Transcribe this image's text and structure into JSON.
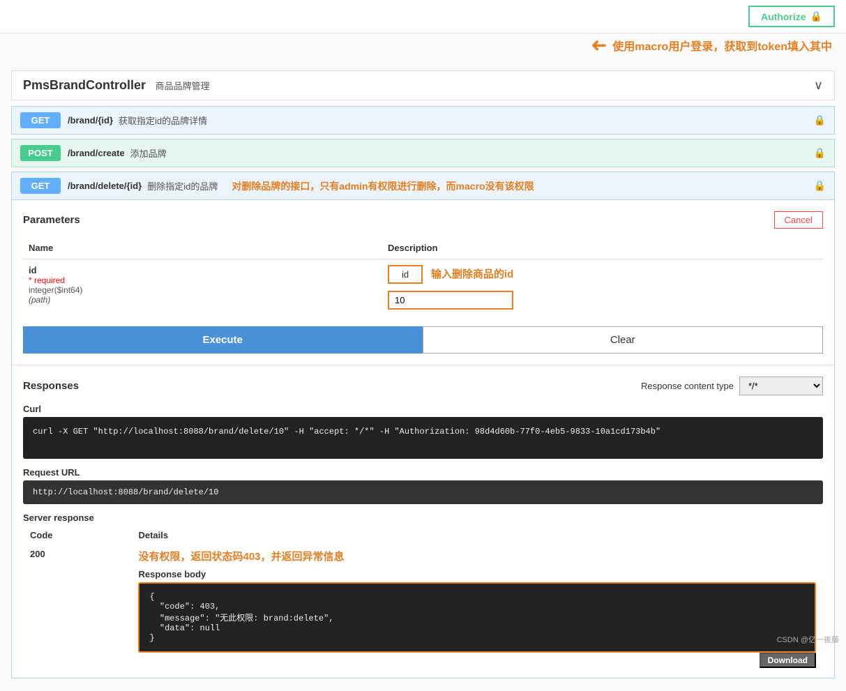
{
  "topbar": {
    "authorize_label": "Authorize",
    "lock_icon": "🔒"
  },
  "annotation": {
    "top_text": "使用macro用户登录，获取到token填入其中",
    "delete_annotation": "对删除品牌的接口，只有admin有权限进行删除，而macro没有该权限",
    "id_annotation": "输入删除商品的id",
    "no_permission_annotation": "没有权限，返回状态码403，并返回异常信息"
  },
  "controller": {
    "title": "PmsBrandController",
    "subtitle": "商品品牌管理"
  },
  "endpoints": [
    {
      "method": "GET",
      "path": "/brand/{id}",
      "desc": "获取指定id的品牌详情"
    },
    {
      "method": "POST",
      "path": "/brand/create",
      "desc": "添加品牌"
    }
  ],
  "expanded_endpoint": {
    "method": "GET",
    "path": "/brand/delete/{id}",
    "desc": "删除指定id的品牌"
  },
  "parameters": {
    "title": "Parameters",
    "cancel_label": "Cancel",
    "columns": {
      "name": "Name",
      "description": "Description"
    },
    "param": {
      "name": "id",
      "required_text": "* required",
      "type": "integer($int64)",
      "location": "(path)",
      "label": "id",
      "value": "10"
    }
  },
  "buttons": {
    "execute": "Execute",
    "clear": "Clear"
  },
  "responses": {
    "title": "Responses",
    "content_type_label": "Response content type",
    "content_type_value": "*/*",
    "curl_label": "Curl",
    "curl_value": "curl -X GET \"http://localhost:8088/brand/delete/10\" -H \"accept: */*\" -H \"Authorization: 98d4d60b-77f0-4eb5-9833-10a1cd173b4b\"",
    "request_url_label": "Request URL",
    "request_url_value": "http://localhost:8088/brand/delete/10",
    "server_response_label": "Server response",
    "code_header": "Code",
    "details_header": "Details",
    "code_200": "200",
    "response_body_label": "Response body",
    "response_body_json": "{\n  \"code\": 403,\n  \"message\": \"无此权限: brand:delete\",\n  \"data\": null\n}",
    "download_label": "Download"
  },
  "watermark": "CSDN @亿一後藤"
}
